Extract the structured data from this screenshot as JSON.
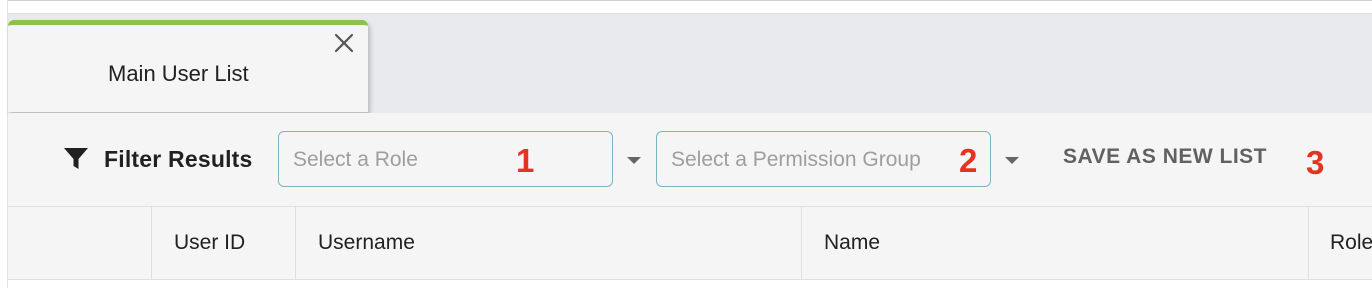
{
  "tab": {
    "label": "Main User List",
    "accent_color": "#8bc34a",
    "close_icon": "close-icon"
  },
  "toolbar": {
    "filter_icon": "filter-icon",
    "filter_label": "Filter Results",
    "role_select": {
      "placeholder": "Select a Role",
      "badge": "1"
    },
    "permission_select": {
      "placeholder": "Select a Permission Group",
      "badge": "2"
    },
    "save_label": "SAVE AS NEW LIST",
    "save_badge": "3",
    "badge_color": "#e53322"
  },
  "table": {
    "columns": [
      {
        "label": ""
      },
      {
        "label": "User ID"
      },
      {
        "label": "Username"
      },
      {
        "label": "Name"
      },
      {
        "label": "Role"
      }
    ]
  }
}
